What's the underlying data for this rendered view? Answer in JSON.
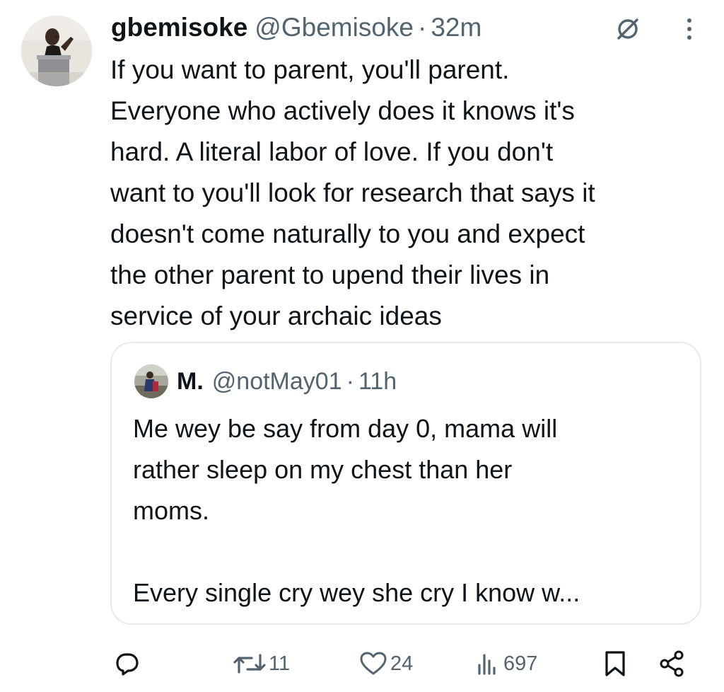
{
  "tweet": {
    "author": {
      "display_name": "gbemisoke",
      "handle": "@Gbemisoke",
      "avatar_icon": "profile-photo-speaker-at-podium"
    },
    "separator": "·",
    "time": "32m",
    "text": "If you want to parent, you'll parent.\nEveryone who actively does it knows it's\nhard. A literal labor of love. If you don't\nwant to you'll look for research that says it\ndoesn't come naturally to you and expect\nthe other parent to upend their lives in\nservice of your archaic ideas"
  },
  "quote": {
    "author": {
      "display_name": "M.",
      "handle": "@notMay01",
      "avatar_icon": "profile-photo-person-outdoors"
    },
    "separator": "·",
    "time": "11h",
    "text": "Me wey be say from day 0, mama will\nrather sleep on my chest than her\nmoms.\n\nEvery single cry wey she cry I know w..."
  },
  "actions": {
    "reply": {
      "icon": "reply-icon",
      "count": ""
    },
    "retweet": {
      "icon": "retweet-icon",
      "count": "11"
    },
    "like": {
      "icon": "heart-icon",
      "count": "24"
    },
    "views": {
      "icon": "views-icon",
      "count": "697"
    },
    "bookmark": {
      "icon": "bookmark-icon"
    },
    "share": {
      "icon": "share-icon"
    }
  },
  "colors": {
    "text_primary": "#0f1419",
    "text_secondary": "#536471",
    "border": "#e6eaed",
    "background": "#ffffff"
  }
}
